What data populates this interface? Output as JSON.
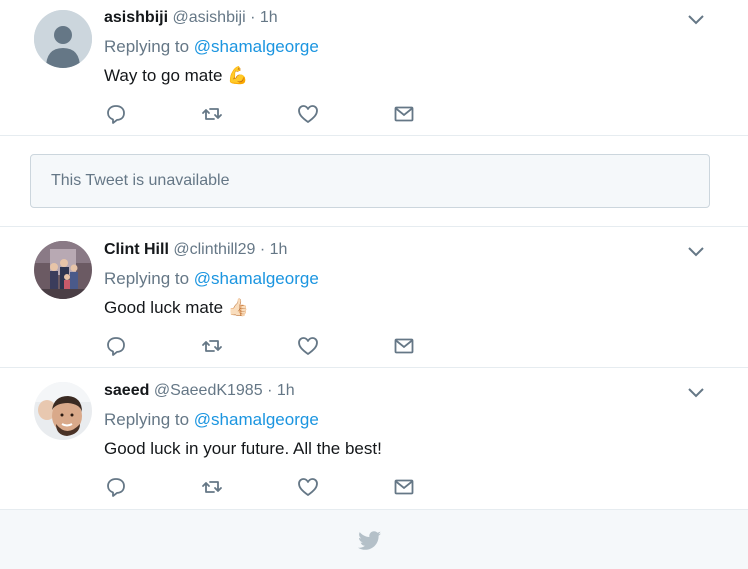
{
  "tweets": [
    {
      "name": "asishbiji",
      "handle": "@asishbiji",
      "dot": "·",
      "time": "1h",
      "replying_prefix": "Replying to ",
      "replying_to": "@shamalgeorge",
      "text": "Way to go mate",
      "emoji": "💪"
    },
    {
      "name": "Clint Hill",
      "handle": "@clinthill29",
      "dot": "·",
      "time": "1h",
      "replying_prefix": "Replying to ",
      "replying_to": "@shamalgeorge",
      "text": "Good luck mate",
      "emoji": "👍🏻"
    },
    {
      "name": "saeed",
      "handle": "@SaeedK1985",
      "dot": "·",
      "time": "1h",
      "replying_prefix": "Replying to ",
      "replying_to": "@shamalgeorge",
      "text": "Good luck in your future. All the best!",
      "emoji": ""
    }
  ],
  "unavailable_notice": "This Tweet is unavailable",
  "icons": {
    "reply": "reply-icon",
    "retweet": "retweet-icon",
    "like": "heart-icon",
    "dm": "envelope-icon",
    "caret": "chevron-down-icon",
    "footer": "twitter-bird-icon"
  },
  "colors": {
    "link": "#1b95e0",
    "muted": "#657786",
    "icon": "#657786",
    "border": "#e6ecf0",
    "background_muted": "#f5f8fa"
  }
}
